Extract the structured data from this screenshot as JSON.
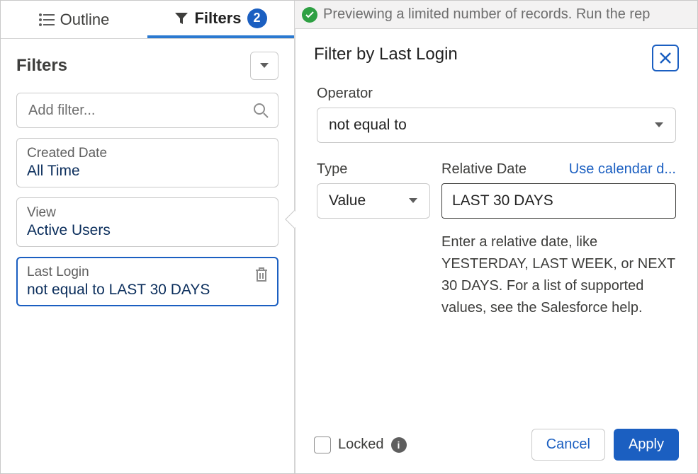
{
  "tabs": {
    "outline": "Outline",
    "filters": "Filters",
    "badge": "2"
  },
  "sidebar": {
    "title": "Filters",
    "search_placeholder": "Add filter...",
    "cards": [
      {
        "label": "Created Date",
        "value": "All Time"
      },
      {
        "label": "View",
        "value": "Active Users"
      },
      {
        "label": "Last Login",
        "value": "not equal to LAST 30 DAYS"
      }
    ]
  },
  "preview_bar": "Previewing a limited number of records. Run the rep",
  "panel": {
    "title": "Filter by Last Login",
    "operator_label": "Operator",
    "operator_value": "not equal to",
    "type_label": "Type",
    "type_value": "Value",
    "relative_date_label": "Relative Date",
    "calendar_link": "Use calendar d...",
    "relative_date_value": "LAST 30 DAYS",
    "help_text": "Enter a relative date, like YESTERDAY, LAST WEEK, or NEXT 30 DAYS. For a list of supported values, see the Salesforce help.",
    "locked_label": "Locked",
    "cancel": "Cancel",
    "apply": "Apply"
  }
}
